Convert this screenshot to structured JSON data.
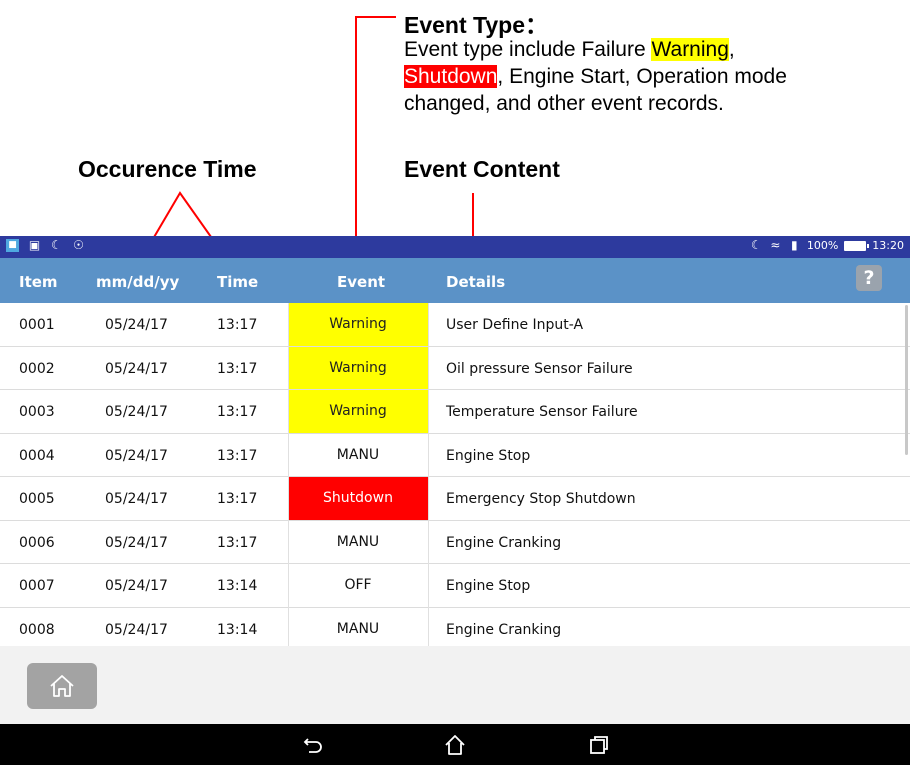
{
  "annotations": {
    "event_type_title": "Event Type：",
    "event_type_desc_1": "Event type include Failure ",
    "event_type_warning": "Warning",
    "event_type_comma": ",",
    "event_type_shutdown": "Shutdown",
    "event_type_desc_2": ", Engine Start, Operation mode",
    "event_type_desc_3": "changed, and other event records.",
    "occurrence_time": "Occurence Time",
    "event_content": "Event Content"
  },
  "status_bar": {
    "battery": "100%",
    "clock": "13:20"
  },
  "table": {
    "headers": {
      "item": "Item",
      "date": "mm/dd/yy",
      "time": "Time",
      "event": "Event",
      "details": "Details"
    },
    "help_label": "?",
    "rows": [
      {
        "item": "0001",
        "date": "05/24/17",
        "time": "13:17",
        "event": "Warning",
        "event_status": "warning",
        "details": "User Define Input-A"
      },
      {
        "item": "0002",
        "date": "05/24/17",
        "time": "13:17",
        "event": "Warning",
        "event_status": "warning",
        "details": "Oil pressure Sensor Failure"
      },
      {
        "item": "0003",
        "date": "05/24/17",
        "time": "13:17",
        "event": "Warning",
        "event_status": "warning",
        "details": "Temperature Sensor Failure"
      },
      {
        "item": "0004",
        "date": "05/24/17",
        "time": "13:17",
        "event": "MANU",
        "event_status": "normal",
        "details": "Engine Stop"
      },
      {
        "item": "0005",
        "date": "05/24/17",
        "time": "13:17",
        "event": "Shutdown",
        "event_status": "shutdown",
        "details": "Emergency Stop Shutdown"
      },
      {
        "item": "0006",
        "date": "05/24/17",
        "time": "13:17",
        "event": "MANU",
        "event_status": "normal",
        "details": "Engine Cranking"
      },
      {
        "item": "0007",
        "date": "05/24/17",
        "time": "13:14",
        "event": "OFF",
        "event_status": "normal",
        "details": "Engine Stop"
      },
      {
        "item": "0008",
        "date": "05/24/17",
        "time": "13:14",
        "event": "MANU",
        "event_status": "normal",
        "details": "Engine Cranking"
      }
    ]
  },
  "colors": {
    "status_bar": "#2d3a9e",
    "header": "#5b92c7",
    "warning": "#ffff00",
    "shutdown": "#ff0000",
    "annotation_line": "#ff0000"
  },
  "icons": {
    "home_button": "home-icon",
    "nav_back": "back-icon",
    "nav_home": "home-icon",
    "nav_recents": "recents-icon"
  }
}
